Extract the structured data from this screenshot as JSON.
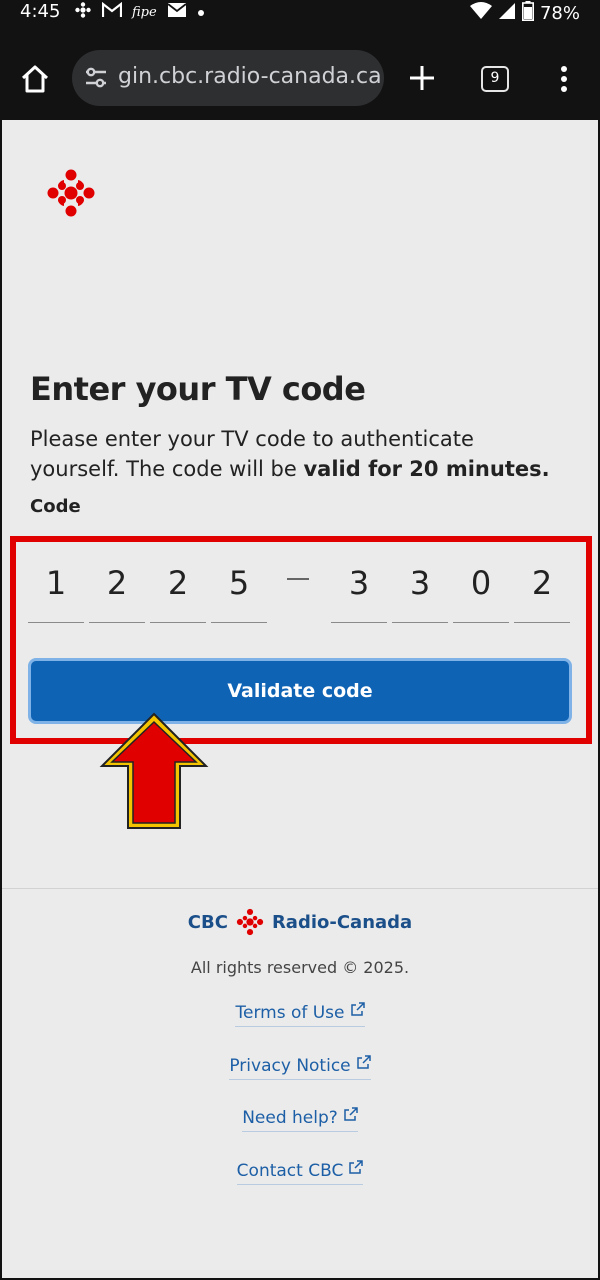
{
  "status_bar": {
    "time": "4:45",
    "battery": "78%",
    "icons": [
      "cbc-gem-icon",
      "gmail-icon",
      "app-icon",
      "mail-icon",
      "dot-icon",
      "wifi-icon",
      "signal-icon",
      "battery-icon"
    ]
  },
  "browser": {
    "url": "gin.cbc.radio-canada.ca",
    "tab_count": "9"
  },
  "page": {
    "heading": "Enter your TV code",
    "description_prefix": "Please enter your TV code to authenticate yourself. The code will be ",
    "description_bold": "valid for 20 minutes.",
    "code_label": "Code",
    "code_digits": [
      "1",
      "2",
      "2",
      "5",
      "3",
      "3",
      "0",
      "2"
    ],
    "validate_button": "Validate code"
  },
  "footer": {
    "brand_left": "CBC",
    "brand_right": "Radio-Canada",
    "rights": "All rights reserved © 2025.",
    "links": [
      "Terms of Use",
      "Privacy Notice",
      "Need help?",
      "Contact CBC"
    ]
  },
  "colors": {
    "accent_blue": "#0f63b5",
    "cbc_red": "#e00000",
    "highlight_red": "#e00000",
    "arrow_fill": "#e00000",
    "arrow_outline": "#f5c400",
    "link_blue": "#1d5fa6"
  }
}
